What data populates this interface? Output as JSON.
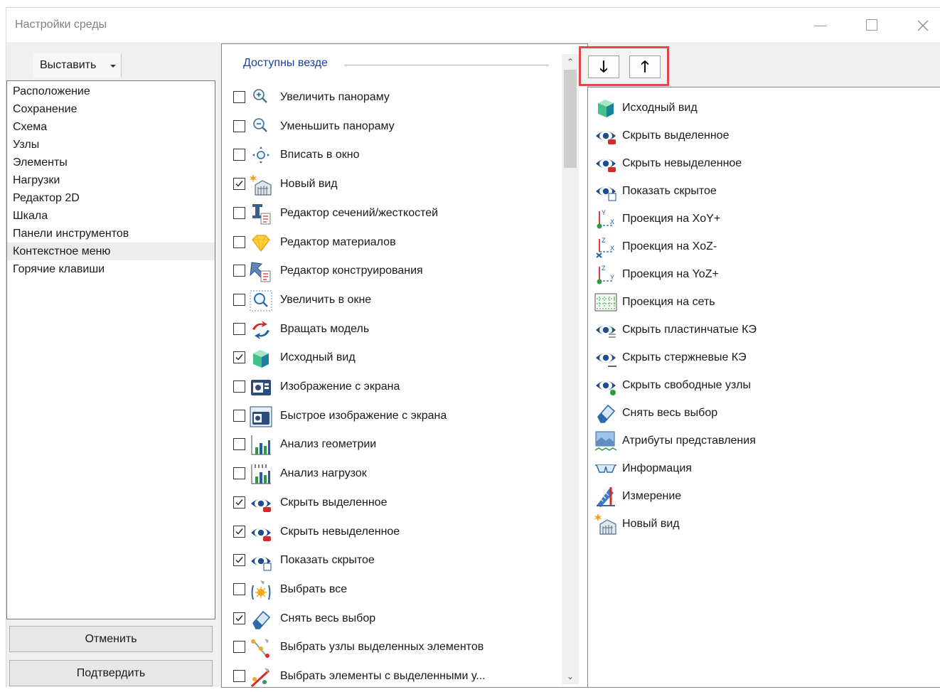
{
  "window": {
    "title": "Настройки среды"
  },
  "left": {
    "insert_button": "Выставить",
    "items": [
      "Расположение",
      "Сохранение",
      "Схема",
      "Узлы",
      "Элементы",
      "Нагрузки",
      "Редактор 2D",
      "Шкала",
      "Панели инструментов",
      "Контекстное меню",
      "Горячие клавиши"
    ],
    "selected_index": 9,
    "cancel": "Отменить",
    "confirm": "Подтвердить"
  },
  "middle": {
    "group_title": "Доступны везде",
    "items": [
      {
        "label": "Увеличить панораму",
        "checked": false,
        "icon": "zoom-in-icon"
      },
      {
        "label": "Уменьшить панораму",
        "checked": false,
        "icon": "zoom-out-icon"
      },
      {
        "label": "Вписать в окно",
        "checked": false,
        "icon": "fit-window-icon"
      },
      {
        "label": "Новый вид",
        "checked": true,
        "icon": "new-view-icon"
      },
      {
        "label": "Редактор сечений/жесткостей",
        "checked": false,
        "icon": "section-editor-icon"
      },
      {
        "label": "Редактор материалов",
        "checked": false,
        "icon": "material-editor-icon"
      },
      {
        "label": "Редактор конструирования",
        "checked": false,
        "icon": "design-editor-icon"
      },
      {
        "label": "Увеличить в окне",
        "checked": false,
        "icon": "zoom-window-icon"
      },
      {
        "label": "Вращать модель",
        "checked": false,
        "icon": "rotate-model-icon"
      },
      {
        "label": "Исходный вид",
        "checked": true,
        "icon": "cube-icon"
      },
      {
        "label": "Изображение с экрана",
        "checked": false,
        "icon": "screenshot-icon"
      },
      {
        "label": "Быстрое изображение с экрана",
        "checked": false,
        "icon": "quick-screenshot-icon"
      },
      {
        "label": "Анализ геометрии",
        "checked": false,
        "icon": "geometry-analysis-icon"
      },
      {
        "label": "Анализ нагрузок",
        "checked": false,
        "icon": "load-analysis-icon"
      },
      {
        "label": "Скрыть выделенное",
        "checked": true,
        "icon": "hide-selected-icon"
      },
      {
        "label": "Скрыть невыделенное",
        "checked": true,
        "icon": "hide-unselected-icon"
      },
      {
        "label": "Показать скрытое",
        "checked": true,
        "icon": "show-hidden-icon"
      },
      {
        "label": "Выбрать все",
        "checked": false,
        "icon": "select-all-icon"
      },
      {
        "label": "Снять весь выбор",
        "checked": true,
        "icon": "eraser-icon"
      },
      {
        "label": "Выбрать узлы выделенных элементов",
        "checked": false,
        "icon": "select-nodes-icon"
      },
      {
        "label": "Выбрать элементы с выделенными у...",
        "checked": false,
        "icon": "select-elements-icon"
      }
    ]
  },
  "right": {
    "move_down": "🡓",
    "move_up": "🡑",
    "items": [
      {
        "label": "Исходный вид",
        "icon": "cube-icon"
      },
      {
        "label": "Скрыть выделенное",
        "icon": "hide-selected-icon"
      },
      {
        "label": "Скрыть невыделенное",
        "icon": "hide-unselected-icon"
      },
      {
        "label": "Показать скрытое",
        "icon": "show-hidden-icon"
      },
      {
        "label": "Проекция на XoY+",
        "icon": "projection-xoy-icon"
      },
      {
        "label": "Проекция на XoZ-",
        "icon": "projection-xoz-icon"
      },
      {
        "label": "Проекция на YoZ+",
        "icon": "projection-yoz-icon"
      },
      {
        "label": "Проекция на сеть",
        "icon": "projection-grid-icon"
      },
      {
        "label": "Скрыть пластинчатые КЭ",
        "icon": "hide-plates-icon"
      },
      {
        "label": "Скрыть стержневые КЭ",
        "icon": "hide-bars-icon"
      },
      {
        "label": "Скрыть свободные узлы",
        "icon": "hide-free-nodes-icon"
      },
      {
        "label": "Снять весь выбор",
        "icon": "eraser-icon"
      },
      {
        "label": "Атрибуты представления",
        "icon": "display-attributes-icon"
      },
      {
        "label": "Информация",
        "icon": "info-glasses-icon"
      },
      {
        "label": "Измерение",
        "icon": "measure-icon"
      },
      {
        "label": "Новый вид",
        "icon": "new-view-icon"
      }
    ]
  }
}
